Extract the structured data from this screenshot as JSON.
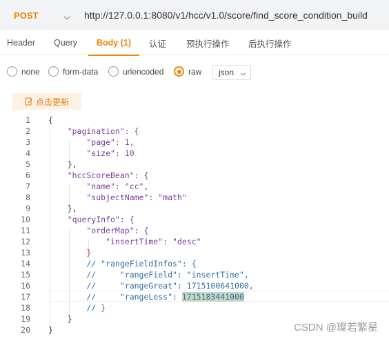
{
  "request": {
    "method": "POST",
    "url": "http://127.0.0.1:8080/v1/hcc/v1.0/score/find_score_condition_build"
  },
  "tabs": [
    {
      "label": "Header"
    },
    {
      "label": "Query"
    },
    {
      "label": "Body (1)"
    },
    {
      "label": "认证"
    },
    {
      "label": "预执行操作"
    },
    {
      "label": "后执行操作"
    }
  ],
  "body_types": [
    {
      "label": "none"
    },
    {
      "label": "form-data"
    },
    {
      "label": "urlencoded"
    },
    {
      "label": "raw"
    }
  ],
  "format_select": {
    "value": "json"
  },
  "update_button": {
    "label": "点击更新"
  },
  "editor": {
    "line_numbers": [
      "1",
      "2",
      "3",
      "4",
      "5",
      "6",
      "7",
      "8",
      "9",
      "10",
      "11",
      "12",
      "13",
      "14",
      "15",
      "16",
      "17",
      "18",
      "19",
      "20"
    ],
    "lines": [
      "{",
      "    \"pagination\": {",
      "        \"page\": 1,",
      "        \"size\": 10",
      "    },",
      "    \"hccScoreBean\": {",
      "        \"name\": \"cc\",",
      "        \"subjectName\": \"math\"",
      "    },",
      "    \"queryInfo\": {",
      "        \"orderMap\": {",
      "            \"insertTime\": \"desc\"",
      "        }",
      "        // \"rangeFieldInfos\": {",
      "        //     \"rangeField\": \"insertTime\",",
      "        //     \"rangeGreat\": 1715100641000,",
      "        //     \"rangeLess\": ",
      "        // }",
      "    }",
      "}"
    ],
    "selected_text": "1715183441000"
  },
  "watermark": "CSDN @璨若繁星"
}
